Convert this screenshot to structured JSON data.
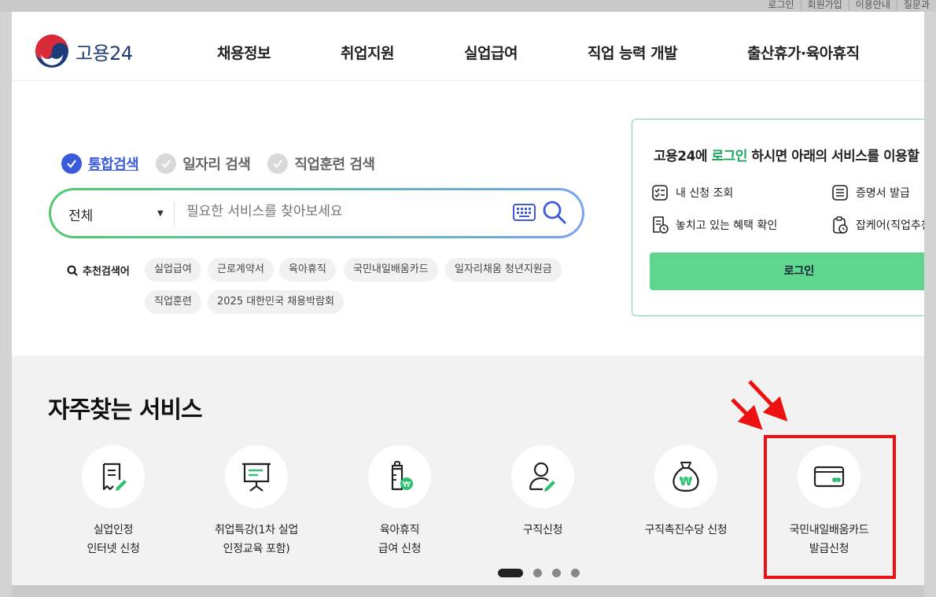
{
  "utility": {
    "links": [
      "로그인",
      "회원가입",
      "이용안내",
      "질문과"
    ]
  },
  "header": {
    "logo_text": "고용24",
    "nav": [
      "채용정보",
      "취업지원",
      "실업급여",
      "직업 능력 개발",
      "출산휴가·육아휴직"
    ]
  },
  "search": {
    "tabs": [
      {
        "label": "통합검색",
        "active": true
      },
      {
        "label": "일자리 검색",
        "active": false
      },
      {
        "label": "직업훈련 검색",
        "active": false
      }
    ],
    "category": "전체",
    "placeholder": "필요한 서비스를 찾아보세요",
    "recommend_title": "추천검색어",
    "keywords": [
      "실업급여",
      "근로계약서",
      "육아휴직",
      "국민내일배움카드",
      "일자리채움 청년지원금",
      "직업훈련",
      "2025 대한민국 채용박람회"
    ]
  },
  "login_panel": {
    "msg_prefix": "고용24에 ",
    "msg_highlight": "로그인",
    "msg_suffix": " 하시면 아래의 서비스를 이용할",
    "services": [
      "내 신청 조회",
      "증명서 발급",
      "놓치고 있는 혜택 확인",
      "잡케어(직업추천"
    ],
    "button_label": "로그인"
  },
  "frequent": {
    "title": "자주찾는 서비스",
    "items": [
      {
        "line1": "실업인정",
        "line2": "인터넷 신청",
        "icon": "document-pen-icon"
      },
      {
        "line1": "취업특강(1차 실업",
        "line2": "인정교육 포함)",
        "icon": "presentation-board-icon"
      },
      {
        "line1": "육아휴직",
        "line2": "급여 신청",
        "icon": "baby-bottle-won-icon"
      },
      {
        "line1": "구직신청",
        "line2": "",
        "icon": "person-pen-icon"
      },
      {
        "line1": "구직촉진수당 신청",
        "line2": "",
        "icon": "money-bag-won-icon"
      },
      {
        "line1": "국민내일배움카드",
        "line2": "발급신청",
        "icon": "card-icon"
      }
    ],
    "pager": {
      "pages": 4,
      "current": 1
    }
  },
  "colors": {
    "brand_green": "#5fd58e",
    "brand_blue": "#3b5bdb",
    "annotation_red": "#ee1111"
  }
}
